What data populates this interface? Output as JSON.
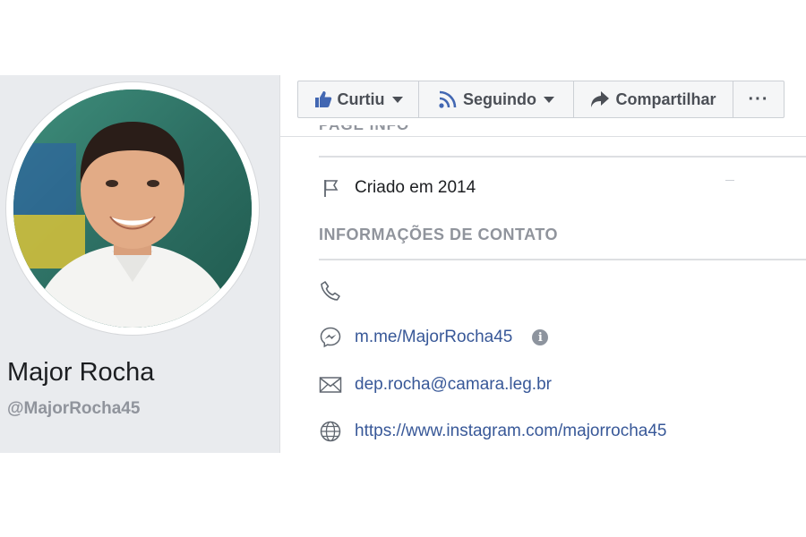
{
  "profile": {
    "name": "Major Rocha",
    "handle": "@MajorRocha45"
  },
  "actions": {
    "like_label": "Curtiu",
    "follow_label": "Seguindo",
    "share_label": "Compartilhar",
    "more_label": "···"
  },
  "about": {
    "partial_heading": "PAGE INFO",
    "created": "Criado em 2014",
    "contact_title": "INFORMAÇÕES DE CONTATO",
    "messenger": "m.me/MajorRocha45",
    "email": "dep.rocha@camara.leg.br",
    "website": "https://www.instagram.com/majorrocha45"
  },
  "icons": {
    "like": "thumbs-up-icon",
    "follow": "rss-icon",
    "share": "share-arrow-icon",
    "created": "flag-icon",
    "phone": "phone-icon",
    "messenger": "messenger-icon",
    "email": "envelope-icon",
    "website": "globe-icon",
    "info": "info-icon"
  },
  "colors": {
    "link": "#385898",
    "muted": "#90949c",
    "panel_bg": "#e9ebee",
    "like_blue": "#4267b2"
  }
}
